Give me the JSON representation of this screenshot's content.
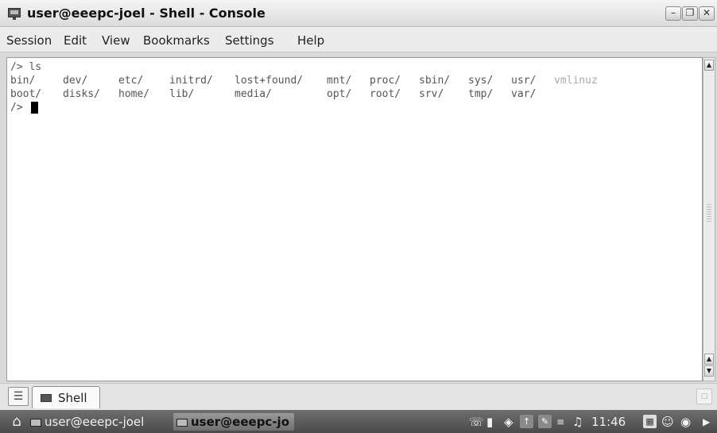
{
  "window": {
    "title": "user@eeepc-joel - Shell - Console",
    "icon": "terminal-icon",
    "controls": [
      "minimize-icon",
      "maximize-icon",
      "close-icon"
    ]
  },
  "menu": [
    "Session",
    "Edit",
    "View",
    "Bookmarks",
    "Settings",
    "Help"
  ],
  "terminal": {
    "prompt_line": "/> ls",
    "listing": [
      [
        "bin/",
        "dev/",
        "etc/",
        "initrd/",
        "lost+found/",
        "mnt/",
        "proc/",
        "sbin/",
        "sys/",
        "usr/",
        "vmlinuz"
      ],
      [
        "boot/",
        "disks/",
        "home/",
        "lib/",
        "media/",
        "",
        "opt/",
        "root/",
        "srv/",
        "tmp/",
        "var/"
      ]
    ],
    "current_prompt": "/>"
  },
  "tabs": [
    {
      "label": "Shell",
      "icon": "terminal-icon",
      "active": true
    }
  ],
  "taskbar": {
    "launcher_icon": "home-icon",
    "tasks": [
      {
        "label": "user@eeepc-joel",
        "icon": "computer-icon",
        "active": false
      },
      {
        "label": "user@eeepc-jo",
        "icon": "terminal-icon",
        "active": true
      }
    ],
    "tray_icons": [
      "network-icon",
      "battery-icon",
      "wifi-icon",
      "update-icon",
      "notes-icon",
      "volume-level-icon",
      "speaker-icon"
    ],
    "clock": "11:46",
    "right_icons": [
      "keyboard-icon",
      "smiley-icon",
      "power-icon",
      "arrow-right-icon"
    ]
  },
  "colors": {
    "terminal_bg": "#ffffff",
    "terminal_fg": "#555555",
    "executable_fg": "#aaaaaa",
    "taskbar_bg": "#5a5a5a"
  }
}
